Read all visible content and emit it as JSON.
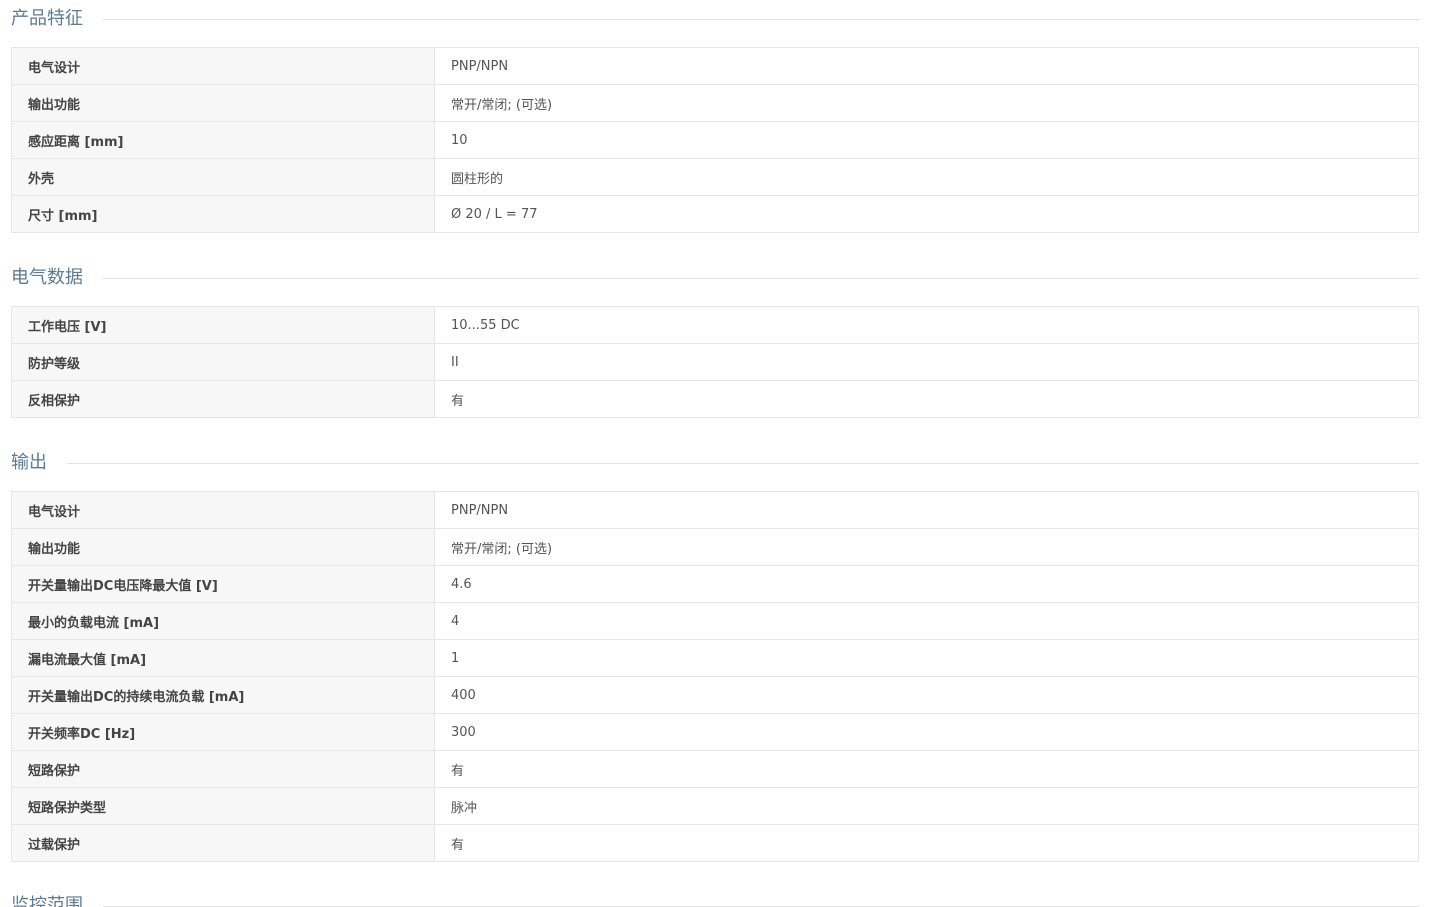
{
  "sections": [
    {
      "title": "产品特征",
      "rows": [
        {
          "label": "电气设计",
          "value": "PNP/NPN"
        },
        {
          "label": "输出功能",
          "value": "常开/常闭; (可选)"
        },
        {
          "label": "感应距离 [mm]",
          "value": "10"
        },
        {
          "label": "外壳",
          "value": "圆柱形的"
        },
        {
          "label": "尺寸 [mm]",
          "value": "Ø 20 / L = 77"
        }
      ]
    },
    {
      "title": "电气数据",
      "rows": [
        {
          "label": "工作电压 [V]",
          "value": "10...55 DC"
        },
        {
          "label": "防护等级",
          "value": "II"
        },
        {
          "label": "反相保护",
          "value": "有"
        }
      ]
    },
    {
      "title": "输出",
      "rows": [
        {
          "label": "电气设计",
          "value": "PNP/NPN"
        },
        {
          "label": "输出功能",
          "value": "常开/常闭; (可选)"
        },
        {
          "label": "开关量输出DC电压降最大值 [V]",
          "value": "4.6"
        },
        {
          "label": "最小的负载电流 [mA]",
          "value": "4"
        },
        {
          "label": "漏电流最大值 [mA]",
          "value": "1"
        },
        {
          "label": "开关量输出DC的持续电流负载 [mA]",
          "value": "400"
        },
        {
          "label": "开关频率DC [Hz]",
          "value": "300"
        },
        {
          "label": "短路保护",
          "value": "有"
        },
        {
          "label": "短路保护类型",
          "value": "脉冲"
        },
        {
          "label": "过载保护",
          "value": "有"
        }
      ]
    },
    {
      "title": "监控范围",
      "rows": []
    }
  ]
}
